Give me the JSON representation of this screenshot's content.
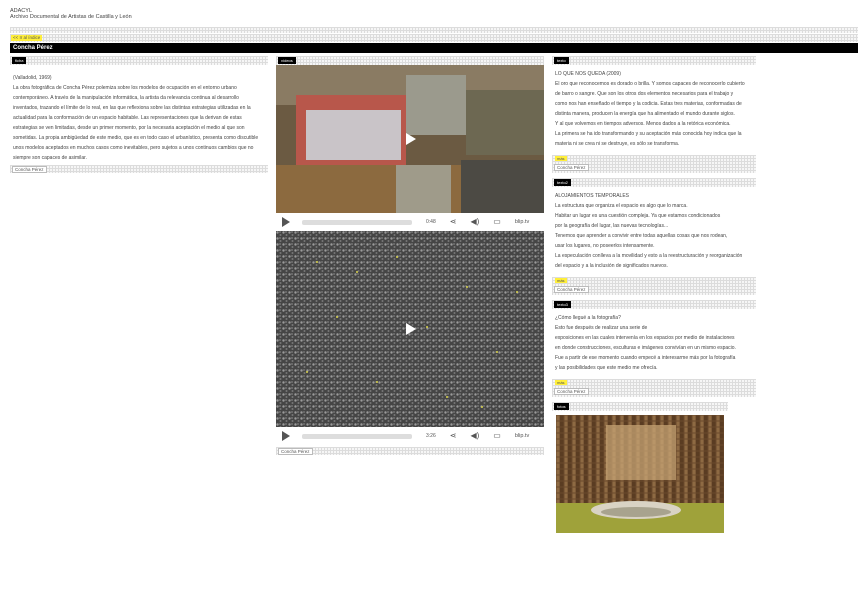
{
  "header": {
    "org": "ADACYL",
    "subtitle": "Archivo Documental de Artistas de Castilla y León"
  },
  "nav": {
    "back_label": "<< Ir al índice"
  },
  "artist": {
    "name": "Concha Pérez"
  },
  "ficha": {
    "tag": "ficha",
    "lines": [
      "(Valladolid, 1969)",
      "La obra fotográfica de Concha Pérez polemiza sobre los modelos de ocupación en el entorno urbano",
      "contemporáneo. A través de la manipulación informática, la artista da relevancia continua al desarrollo",
      "inventados, trazando el límite de lo real, en las que reflexiona sobre las distintas estrategias utilizadas en la",
      "actualidad para la conformación de un espacio habitable. Las representaciones que la derivan de estas",
      "estrategias se ven limitadas, desde un primer momento, por la necesaria aceptación el medio al que son",
      "sometidas. La propia ambigüedad de este medio, que es en todo caso el urbanístico, presenta como discutible",
      "unos modelos aceptados en muchos casos como inevitables, pero sujetos a unos continuos cambios que no",
      "siempre son capaces de asimilar."
    ],
    "author": "Concha Pérez"
  },
  "videos": {
    "tag": "vídeos",
    "items": [
      {
        "time": "0:48",
        "brand": "blip.tv"
      },
      {
        "time": "3:26",
        "brand": "blip.tv"
      }
    ],
    "author": "Concha Pérez"
  },
  "texts": [
    {
      "tag": "texto",
      "lines": [
        "LO QUE NOS QUEDA (2009)",
        "El oro que reconocemos es dorado o brilla. Y somos capaces de reconocerlo cubierto",
        "de barro o sangre. Que son los otros dos elementos necesarios para el trabajo y",
        "como nos han enseñado el tiempo y la codicia. Estas tres materias, conformadas de",
        "distinta manera, producen la energía que ha alimentado el mundo durante siglos.",
        "Y al que volvemos en tiempos adversos. Menos dados a la retórica económica.",
        "La primera se ha ido transformando y su aceptación más conocida hoy indica que la",
        "materia ni se crea ni se destruye, es sólo se transforma."
      ],
      "more": "más",
      "author": "Concha Pérez"
    },
    {
      "tag": "texto2",
      "lines": [
        "ALOJAMIENTOS TEMPORALES",
        "La estructura que organiza el espacio es algo que lo marca.",
        "Habitar un lugar es una cuestión compleja. Ya que estamos condicionados",
        "por la geografía del lugar, las nuevas tecnologías...",
        "Tenemos que aprender a convivir entre todas aquellas cosas que nos rodean,",
        "usar los lugares, no poseerlos intensamente.",
        "La especulación conlleva a la movilidad y esto a la reestructuración y reorganización",
        "del espacio y a la inclusión de significados nuevos."
      ],
      "more": "más",
      "author": "Concha Pérez"
    },
    {
      "tag": "texto3",
      "lines": [
        "¿Cómo llegué a la fotografía?",
        "Esto fue después de realizar una serie de",
        "exposiciones en las cuales intervenía en los espacios por medio de instalaciones",
        "en donde construcciones, esculturas e imágenes convivían en un mismo espacio.",
        "Fue a partir de ese momento cuando empecé a interesarme más por la fotografía",
        "y las posibilidades que este medio me ofrecía."
      ],
      "more": "más",
      "author": "Concha Pérez"
    }
  ],
  "fotos": {
    "tag": "fotos"
  }
}
